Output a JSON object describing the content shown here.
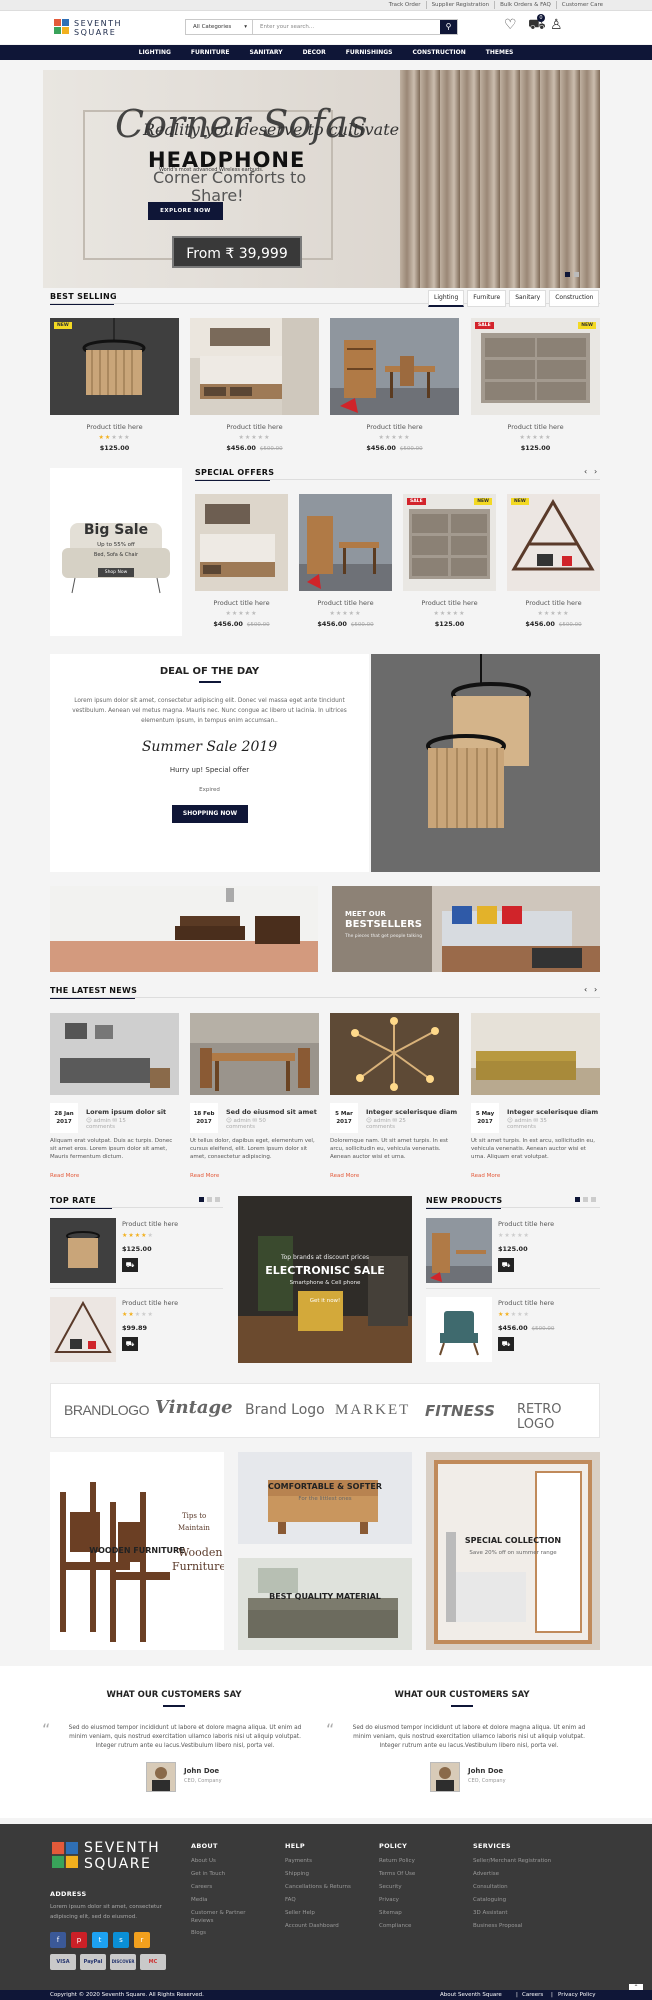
{
  "topbar": {
    "links": [
      "Track Order",
      "Supplier Registration",
      "Bulk Orders & FAQ",
      "Customer Care"
    ]
  },
  "brand": {
    "line1": "SEVENTH",
    "line2": "SQUARE"
  },
  "search": {
    "category": "All Categories",
    "placeholder": "Enter your search..."
  },
  "header": {
    "cart_count": "0",
    "icons": [
      "search-icon",
      "heart-icon",
      "cart-icon",
      "user-icon"
    ]
  },
  "nav": [
    "LIGHTING",
    "FURNITURE",
    "SANITARY",
    "DECOR",
    "FURNISHINGS",
    "CONSTRUCTION",
    "THEMES"
  ],
  "hero": {
    "script": "Corner Sofas",
    "script2": "Reality you deserve to cultivate",
    "headline": "HEADPHONE",
    "subtext": "World's most advanced Wireless earbuds.",
    "line1": "Corner Comforts to",
    "line2": "Share!",
    "cta": "EXPLORE NOW",
    "price": "From ₹ 39,999"
  },
  "best_selling": {
    "title": "BEST SELLING",
    "tabs": [
      "Lighting",
      "Furniture",
      "Sanitary",
      "Construction"
    ],
    "products": [
      {
        "title": "Product title here",
        "price": "$125.00",
        "old": "",
        "badge": "NEW",
        "badge2": "",
        "rating": 2
      },
      {
        "title": "Product title here",
        "price": "$456.00",
        "old": "$500.00",
        "badge": "",
        "badge2": "",
        "rating": 0
      },
      {
        "title": "Product title here",
        "price": "$456.00",
        "old": "$500.00",
        "badge": "",
        "badge2": "",
        "rating": 0
      },
      {
        "title": "Product title here",
        "price": "$125.00",
        "old": "",
        "badge": "SALE",
        "badge2": "NEW",
        "rating": 0
      }
    ]
  },
  "promo": {
    "title": "Big Sale",
    "line1": "Up to 55% off",
    "line2": "Bed, Sofa & Chair",
    "cta": "Shop Now"
  },
  "special_offers": {
    "title": "SPECIAL OFFERS",
    "products": [
      {
        "title": "Product title here",
        "price": "$456.00",
        "old": "$500.00",
        "badge": "",
        "badge2": ""
      },
      {
        "title": "Product title here",
        "price": "$456.00",
        "old": "$500.00",
        "badge": "",
        "badge2": ""
      },
      {
        "title": "Product title here",
        "price": "$125.00",
        "old": "",
        "badge": "SALE",
        "badge2": "NEW"
      },
      {
        "title": "Product title here",
        "price": "$456.00",
        "old": "$500.00",
        "badge": "NEW",
        "badge2": ""
      }
    ]
  },
  "deal": {
    "title": "DEAL OF THE DAY",
    "text": "Lorem ipsum dolor sit amet, consectetur adipiscing elit. Donec vel massa eget ante tincidunt vestibulum. Aenean vel metus magna. Mauris nec. Nunc congue ac libero ut lacinia. In ultrices elementum ipsum, in tempus enim accumsan..",
    "script": "Summer Sale 2019",
    "hurry": "Hurry up! Special offer",
    "expired": "Expired",
    "cta": "SHOPPING NOW"
  },
  "banner2": {
    "title1": "MEET OUR",
    "title2": "BESTSELLERS",
    "sub": "The pieces that get people talking"
  },
  "news": {
    "title": "THE LATEST NEWS",
    "items": [
      {
        "day": "28 Jan",
        "year": "2017",
        "title": "Lorem ipsum dolor sit",
        "author": "admin",
        "comments": "15",
        "comments_label": "comments",
        "text": "Aliquam erat volutpat. Duis ac turpis. Donec sit amet eros. Lorem ipsum dolor sit amet, Mauris fermentum dictum.",
        "more": "Read More"
      },
      {
        "day": "18 Feb",
        "year": "2017",
        "title": "Sed do eiusmod sit amet",
        "author": "admin",
        "comments": "50",
        "comments_label": "comments",
        "text": "Ut tellus dolor, dapibus eget, elementum vel, cursus eleifend, elit. Lorem ipsum dolor sit amet, consectetur adipiscing.",
        "more": "Read More"
      },
      {
        "day": "5 Mar",
        "year": "2017",
        "title": "Integer scelerisque diam",
        "author": "admin",
        "comments": "25",
        "comments_label": "comments",
        "text": "Doloremque nam. Ut sit amet turpis. In est arcu, sollicitudin eu, vehicula venenatis. Aenean auctor wisi et urna.",
        "more": "Read More"
      },
      {
        "day": "5 May",
        "year": "2017",
        "title": "Integer scelerisque diam",
        "author": "admin",
        "comments": "35",
        "comments_label": "comments",
        "text": "Ut sit amet turpis. In est arcu, sollicitudin eu, vehicula venenatis. Aenean auctor wisi et urna. Aliquam erat volutpat.",
        "more": "Read More"
      }
    ]
  },
  "top_rate": {
    "title": "TOP RATE",
    "items": [
      {
        "title": "Product title here",
        "price": "$125.00",
        "old": "",
        "rating": 4
      },
      {
        "title": "Product title here",
        "price": "$99.89",
        "old": "",
        "rating": 2
      }
    ]
  },
  "electronic": {
    "small": "Top brands at discount prices",
    "title": "ELECTRONISC SALE",
    "sub": "Smartphone & Cell phone",
    "cta": "Get it now!"
  },
  "new_products": {
    "title": "NEW PRODUCTS",
    "items": [
      {
        "title": "Product title here",
        "price": "$125.00",
        "old": "",
        "rating": 0
      },
      {
        "title": "Product title here",
        "price": "$456.00",
        "old": "$500.00",
        "rating": 2
      }
    ]
  },
  "brands": [
    "BRANDLOGO",
    "Vintage",
    "Brand Logo",
    "MARKET",
    "FITNESS",
    "RETRO LOGO"
  ],
  "collections": {
    "wooden": {
      "title": "WOODEN FURNITURE",
      "tag1": "Tips to",
      "tag2": "Maintain",
      "tag3": "Wooden",
      "tag4": "Furniture"
    },
    "comfortable": {
      "title": "COMFORTABLE & SOFTER",
      "sub": "For the littlest ones"
    },
    "quality": {
      "title": "BEST QUALITY MATERIAL"
    },
    "special": {
      "title": "SPECIAL COLLECTION",
      "sub": "Save 20% off on summer range"
    }
  },
  "testimonials": [
    {
      "heading": "WHAT OUR CUSTOMERS SAY",
      "text": "Sed do eiusmod tempor incididunt ut labore et dolore magna aliqua. Ut enim ad minim veniam, quis nostrud exercitation ullamco laboris nisi ut aliquip volutpat. Integer rutrum ante eu lacus.Vestibulum libero nisl, porta vel.",
      "name": "John Doe",
      "role": "CEO, Company"
    },
    {
      "heading": "WHAT OUR CUSTOMERS SAY",
      "text": "Sed do eiusmod tempor incididunt ut labore et dolore magna aliqua. Ut enim ad minim veniam, quis nostrud exercitation ullamco laboris nisi ut aliquip volutpat. Integer rutrum ante eu lacus.Vestibulum libero nisl, porta vel.",
      "name": "John Doe",
      "role": "CEO, Company"
    }
  ],
  "footer": {
    "address_title": "ADDRESS",
    "address": "Lorem ipsum dolor sit amet, consectetur adipiscing elit, sed do eiusmod.",
    "about": {
      "title": "ABOUT",
      "links": [
        "About Us",
        "Get in Touch",
        "Careers",
        "Media",
        "Customer & Partner Reviews",
        "Blogs"
      ]
    },
    "help": {
      "title": "HELP",
      "links": [
        "Payments",
        "Shipping",
        "Cancellations & Returns",
        "FAQ",
        "Seller Help",
        "Account Dashboard"
      ]
    },
    "policy": {
      "title": "POLICY",
      "links": [
        "Return Policy",
        "Terms Of Use",
        "Security",
        "Privacy",
        "Sitemap",
        "Compliance"
      ]
    },
    "services": {
      "title": "SERVICES",
      "links": [
        "Seller/Merchant Registration",
        "Advertise",
        "Consultation",
        "Cataloguing",
        "3D Assistant",
        "Business Proposal"
      ]
    },
    "payments": [
      "VISA",
      "PayPal",
      "DISCOVER",
      "MC"
    ]
  },
  "copyright": {
    "text": "Copyright © 2020 Seventh Square. All Rights Reserved.",
    "links": [
      "About Seventh Square",
      "Careers",
      "Privacy Policy"
    ]
  },
  "colors": {
    "navy": "#0f1637",
    "accent": "#e35a3a",
    "star": "#f2b01e"
  }
}
